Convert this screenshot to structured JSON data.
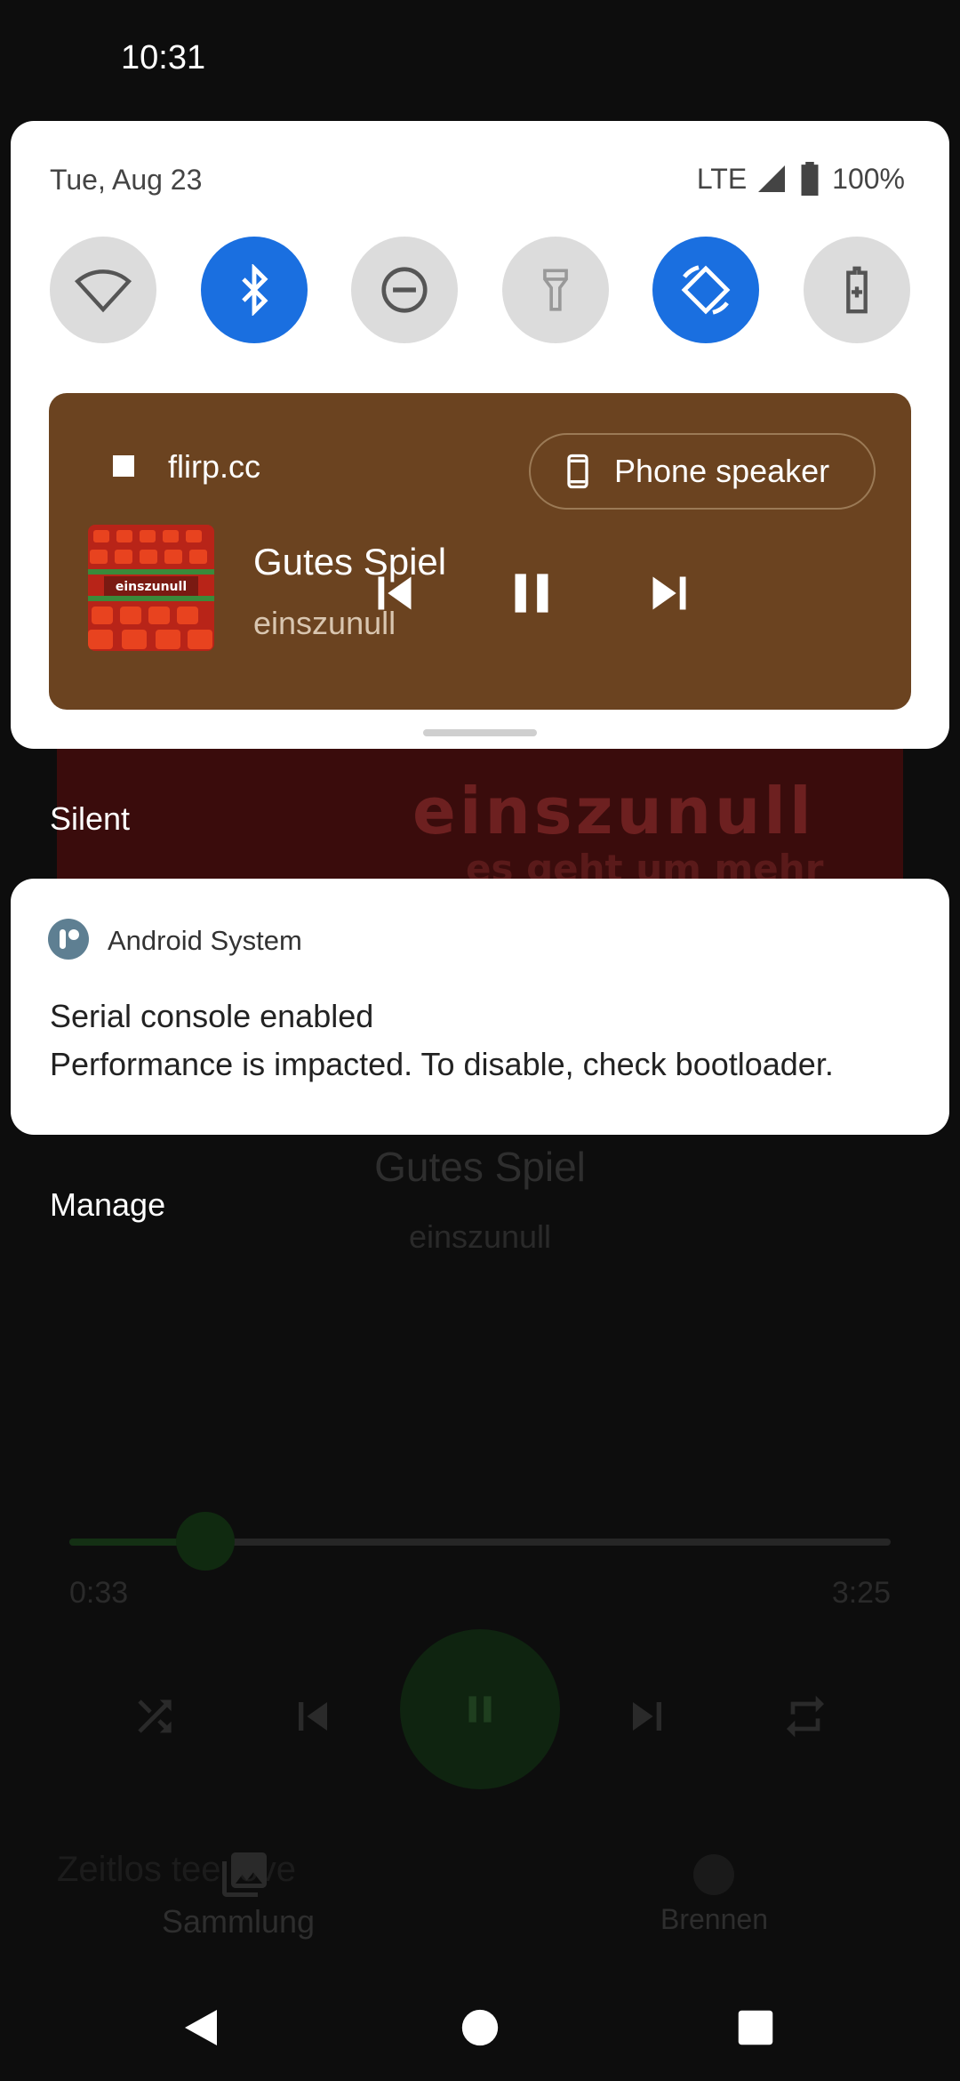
{
  "status_bar": {
    "time": "10:31"
  },
  "quick_settings": {
    "date": "Tue, Aug 23",
    "network": "LTE",
    "battery": "100%",
    "tiles": [
      {
        "name": "wifi",
        "icon": "wifi-icon",
        "active": false
      },
      {
        "name": "bluetooth",
        "icon": "bluetooth-icon",
        "active": true
      },
      {
        "name": "do-not-disturb",
        "icon": "dnd-icon",
        "active": false
      },
      {
        "name": "flashlight",
        "icon": "flashlight-icon",
        "active": false
      },
      {
        "name": "auto-rotate",
        "icon": "rotate-icon",
        "active": true
      },
      {
        "name": "battery-saver",
        "icon": "battery-saver-icon",
        "active": false
      }
    ],
    "colors": {
      "active_tile": "#1a6fe0",
      "inactive_tile": "#dcdcdc",
      "media_card": "#6b4320"
    }
  },
  "media": {
    "app_name": "flirp.cc",
    "output_label": "Phone speaker",
    "title": "Gutes Spiel",
    "artist": "einszunull",
    "album_text": "einszunull"
  },
  "sections": {
    "silent": "Silent",
    "manage": "Manage"
  },
  "notification": {
    "app": "Android System",
    "title": "Serial console enabled",
    "text": "Performance is impacted. To disable, check bootloader."
  },
  "background_app": {
    "art_title": "einszunull",
    "art_subtitle": "es geht um mehr",
    "title": "Gutes Spiel",
    "artist": "einszunull",
    "elapsed": "0:33",
    "duration": "3:25",
    "progress": 0.155,
    "faded_text": "Zeitlos tee love",
    "tab_left": "Sammlung",
    "tab_right": "Brennen"
  }
}
